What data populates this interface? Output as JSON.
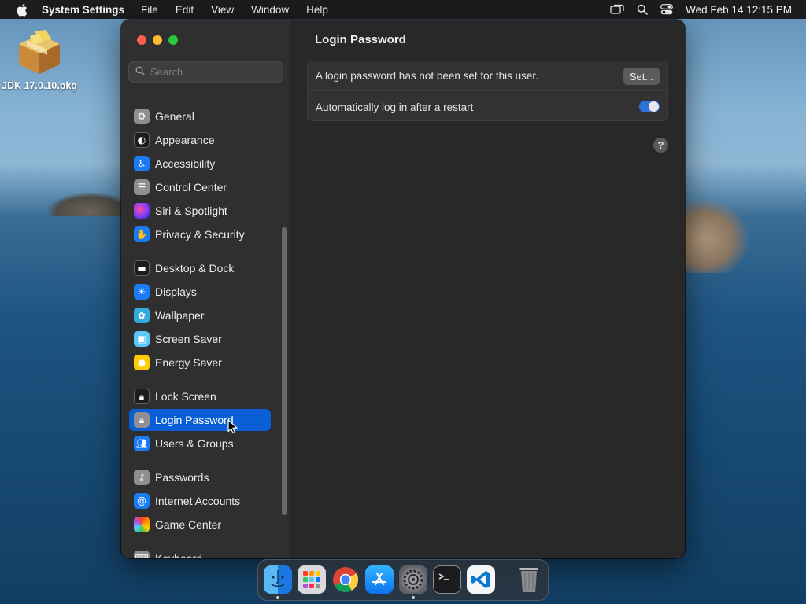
{
  "menubar": {
    "app_name": "System Settings",
    "menus": [
      "File",
      "Edit",
      "View",
      "Window",
      "Help"
    ],
    "status_icons": [
      "screen-mirroring-icon",
      "spotlight-search-icon",
      "control-center-icon"
    ],
    "clock": "Wed Feb 14  12:15 PM"
  },
  "desktop": {
    "file_name": "JDK 17.0.10.pkg"
  },
  "sidebar": {
    "search_placeholder": "Search",
    "items": [
      {
        "label": "General",
        "icon": "gear-icon",
        "color": "#8e8e93"
      },
      {
        "label": "Appearance",
        "icon": "appearance-icon",
        "color": "#1c1c1e"
      },
      {
        "label": "Accessibility",
        "icon": "accessibility-icon",
        "color": "#1a7cf5"
      },
      {
        "label": "Control Center",
        "icon": "control-center-icon",
        "color": "#8e8e93"
      },
      {
        "label": "Siri & Spotlight",
        "icon": "siri-icon",
        "color": "#a23ad0"
      },
      {
        "label": "Privacy & Security",
        "icon": "hand-icon",
        "color": "#1a7cf5"
      },
      {
        "label": "Desktop & Dock",
        "icon": "dock-icon",
        "color": "#1c1c1e"
      },
      {
        "label": "Displays",
        "icon": "sun-icon",
        "color": "#1a7cf5"
      },
      {
        "label": "Wallpaper",
        "icon": "flower-icon",
        "color": "#34aadc"
      },
      {
        "label": "Screen Saver",
        "icon": "screen-saver-icon",
        "color": "#5ac8fa"
      },
      {
        "label": "Energy Saver",
        "icon": "lightbulb-icon",
        "color": "#ffcc00"
      },
      {
        "label": "Lock Screen",
        "icon": "lock-icon",
        "color": "#1c1c1e"
      },
      {
        "label": "Login Password",
        "icon": "lock-icon",
        "color": "#8e8e93",
        "selected": true
      },
      {
        "label": "Users & Groups",
        "icon": "users-icon",
        "color": "#1a7cf5"
      },
      {
        "label": "Passwords",
        "icon": "key-icon",
        "color": "#8e8e93"
      },
      {
        "label": "Internet Accounts",
        "icon": "at-icon",
        "color": "#1a7cf5"
      },
      {
        "label": "Game Center",
        "icon": "game-center-icon",
        "color": "#ff9500"
      },
      {
        "label": "Keyboard",
        "icon": "keyboard-icon",
        "color": "#8e8e93"
      }
    ]
  },
  "content": {
    "title": "Login Password",
    "password_notice": "A login password has not been set for this user.",
    "set_button": "Set...",
    "auto_login_label": "Automatically log in after a restart",
    "auto_login_enabled": true,
    "help_label": "?"
  },
  "dock": {
    "apps": [
      {
        "name": "Finder",
        "icon": "finder-icon",
        "running": true
      },
      {
        "name": "Launchpad",
        "icon": "launchpad-icon",
        "running": false
      },
      {
        "name": "Google Chrome",
        "icon": "chrome-icon",
        "running": false
      },
      {
        "name": "App Store",
        "icon": "app-store-icon",
        "running": false
      },
      {
        "name": "System Settings",
        "icon": "system-settings-icon",
        "running": true
      },
      {
        "name": "Terminal",
        "icon": "terminal-icon",
        "running": false
      },
      {
        "name": "Visual Studio Code",
        "icon": "vscode-icon",
        "running": false
      },
      {
        "name": "Trash",
        "icon": "trash-icon",
        "running": false
      }
    ]
  }
}
